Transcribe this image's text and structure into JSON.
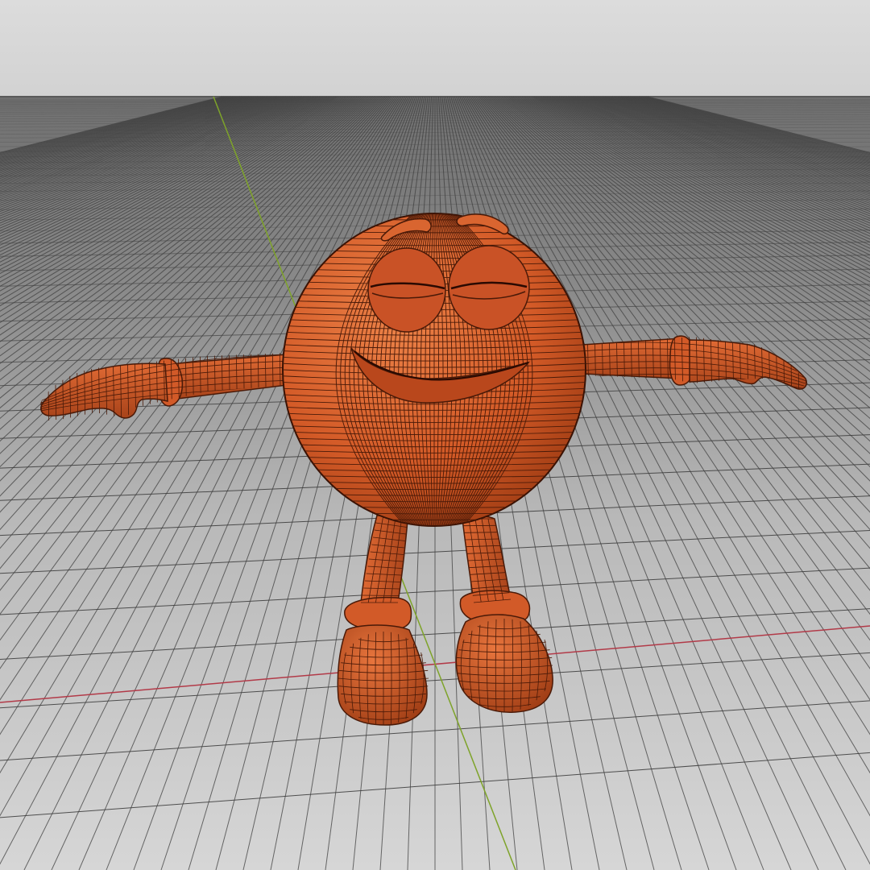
{
  "viewport": {
    "colors": {
      "sky": "#d9d9d9",
      "sky_horizon": "#cfcfcf",
      "floor_far": "#7d7d7d",
      "floor_near": "#cbcbcb",
      "grid_line": "#3c3c3c",
      "axis_x": "#b23a48",
      "axis_y": "#7ea32a",
      "model_fill": "#d55a2a",
      "model_fill_dark": "#a63d15",
      "model_fill_light": "#e6773f",
      "wire": "#4a1a08"
    },
    "icons": [
      "grid-floor",
      "x-axis-line",
      "y-axis-line",
      "character-model"
    ]
  }
}
